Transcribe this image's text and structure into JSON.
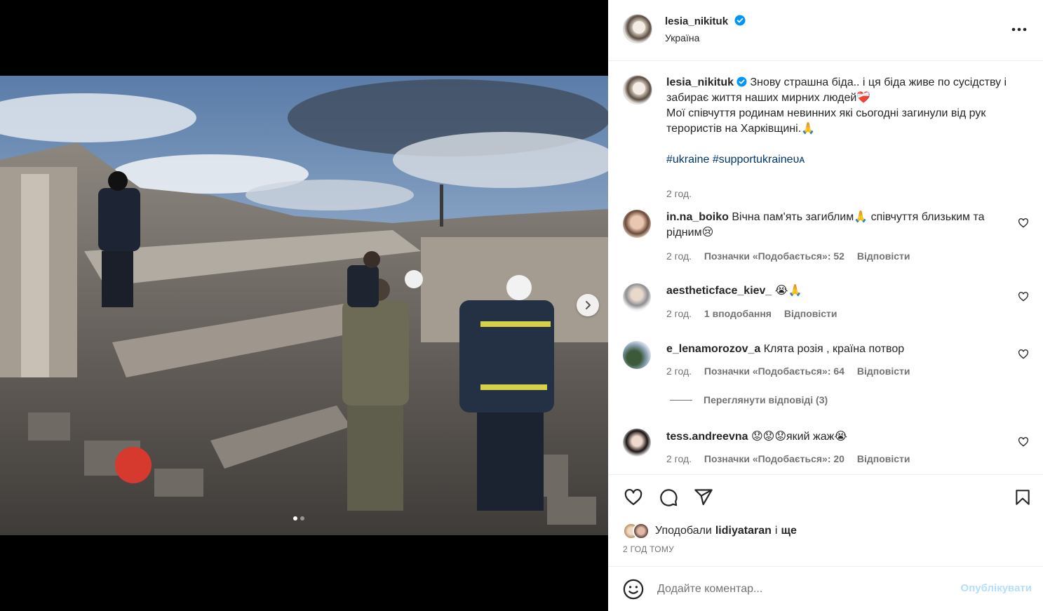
{
  "post": {
    "author": "lesia_nikituk",
    "location": "Україна"
  },
  "caption": {
    "username": "lesia_nikituk",
    "text_line1": "Знову страшна біда.. і ця біда живе по сусідству і забирає життя наших мирних людей❤️‍🩹",
    "text_line2": "Мої співчуття родинам невинних які сьогодні загинули від рук терористів на Харківщині.🙏",
    "hashtags": "#ukraine #supportukraineᴜᴀ",
    "time": "2 год."
  },
  "comments": [
    {
      "username": "in.na_boiko",
      "text": "Вічна пам'ять загиблим🙏 співчуття близьким та рідним😢",
      "time": "2 год.",
      "likes": "Позначки «Подобається»: 52",
      "reply": "Відповісти"
    },
    {
      "username": "aestheticface_kiev_",
      "text": "😭🙏",
      "time": "2 год.",
      "likes": "1 вподобання",
      "reply": "Відповісти"
    },
    {
      "username": "e_lenamorozov_a",
      "text": "Клята розія , країна потвор",
      "time": "2 год.",
      "likes": "Позначки «Подобається»: 64",
      "reply": "Відповісти",
      "view_replies": "Переглянути відповіді (3)"
    },
    {
      "username": "tess.andreevna",
      "text": "😟😟😟який жаж😭",
      "time": "2 год.",
      "likes": "Позначки «Подобається»: 20",
      "reply": "Відповісти"
    }
  ],
  "likes_summary": {
    "prefix": "Уподобали",
    "user": "lidiyataran",
    "conj": "і",
    "more": "ще"
  },
  "posted_ago": "2 ГОД ТОМУ",
  "composer": {
    "placeholder": "Додайте коментар...",
    "post_label": "Опублікувати"
  },
  "carousel": {
    "total": 2,
    "active": 1
  },
  "colors": {
    "verified": "#0095f6",
    "text": "#262626",
    "secondary": "#737373",
    "hashtag": "#00376b",
    "post_disabled": "#b2dffc"
  },
  "icons": [
    "verified-icon",
    "more-options-icon",
    "heart-icon",
    "comment-icon",
    "share-icon",
    "save-icon",
    "emoji-icon",
    "chevron-right-icon"
  ]
}
